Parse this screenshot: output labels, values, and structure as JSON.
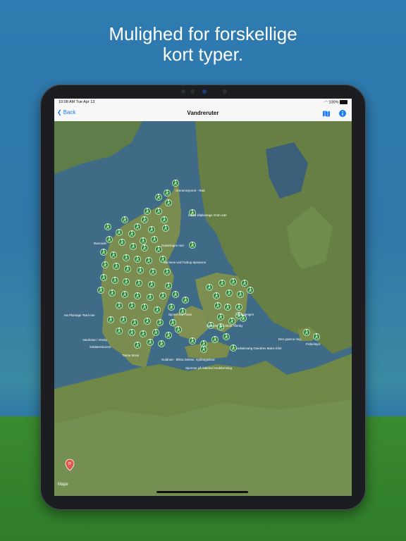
{
  "headline": {
    "line1": "Mulighed for forskellige",
    "line2": "kort typer."
  },
  "status": {
    "time_date": "10:08 AM  Tue Apr 13",
    "battery": "100%"
  },
  "nav": {
    "back_label": "Back",
    "title": "Vandreruter"
  },
  "map": {
    "attribution": "Maps",
    "labels": [
      "Grenenesporet - Rød",
      "Læsø klitplantage Grøn rute",
      "Rønnede",
      "Grønningen rute",
      "Siemens ved Tuttrup-dyssesne",
      "Sporet ved Tissø",
      "Hø Plantage 'Rød rute",
      "Strandengen",
      "Sporene ved Store Tårnby",
      "Vandretur i Vissby",
      "Soldaterskoven",
      "Den grønne ring",
      "Fiskerlejet",
      "Trelde Mose",
      "Guldrute - Østra Dulster, Sydlangeland",
      "Hulsdevang Overdrev Møns Klint",
      "Sporene på Sakstod Hoddemning"
    ],
    "colors": {
      "pin": "#2e8b3a",
      "water": "#3e6a86",
      "land": "#6b8b4a"
    }
  }
}
